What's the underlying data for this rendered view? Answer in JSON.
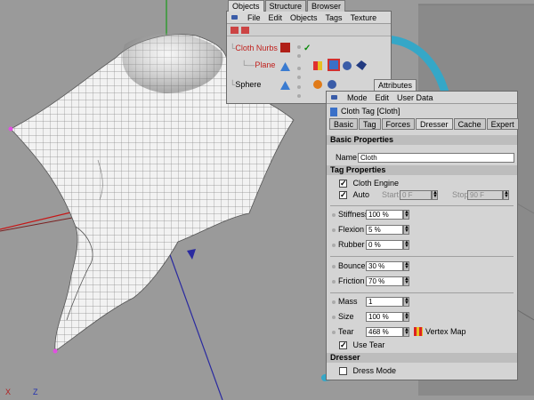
{
  "objects_panel": {
    "tabs": [
      "Objects",
      "Structure",
      "Browser"
    ],
    "menu": [
      "File",
      "Edit",
      "Objects",
      "Tags",
      "Texture"
    ],
    "tree": [
      {
        "label": "Cloth Nurbs",
        "color": "#c0201c"
      },
      {
        "label": "Plane",
        "color": "#c0201c"
      },
      {
        "label": "Sphere",
        "color": "#000000"
      }
    ]
  },
  "attributes_panel": {
    "tab": "Attributes",
    "menu": [
      "Mode",
      "Edit",
      "User Data"
    ],
    "title": "Cloth Tag [Cloth]",
    "tabs": [
      "Basic",
      "Tag",
      "Forces",
      "Dresser",
      "Cache",
      "Expert"
    ],
    "active_tab": "Dresser",
    "basic_properties": "Basic Properties",
    "name_label": "Name",
    "name_value": "Cloth",
    "tag_properties": "Tag Properties",
    "cloth_engine_label": "Cloth Engine",
    "cloth_engine_checked": true,
    "auto_label": "Auto",
    "auto_checked": true,
    "start_label": "Start",
    "start_value": "0 F",
    "stop_label": "Stop",
    "stop_value": "90 F",
    "stiffness_label": "Stiffness",
    "stiffness_value": "100 %",
    "flexion_label": "Flexion",
    "flexion_value": "5 %",
    "rubber_label": "Rubber",
    "rubber_value": "0 %",
    "bounce_label": "Bounce",
    "bounce_value": "30 %",
    "friction_label": "Friction",
    "friction_value": "70 %",
    "mass_label": "Mass",
    "mass_value": "1",
    "size_label": "Size",
    "size_value": "100 %",
    "tear_label": "Tear",
    "tear_value": "468 %",
    "vertex_map_label": "Vertex Map",
    "use_tear_label": "Use Tear",
    "use_tear_checked": true,
    "dresser_section": "Dresser",
    "dress_mode_label": "Dress Mode",
    "dress_mode_checked": false
  },
  "viewport": {
    "axis_x_label": "X",
    "axis_z_label": "Z",
    "arrow_color": "#35a7c7"
  }
}
